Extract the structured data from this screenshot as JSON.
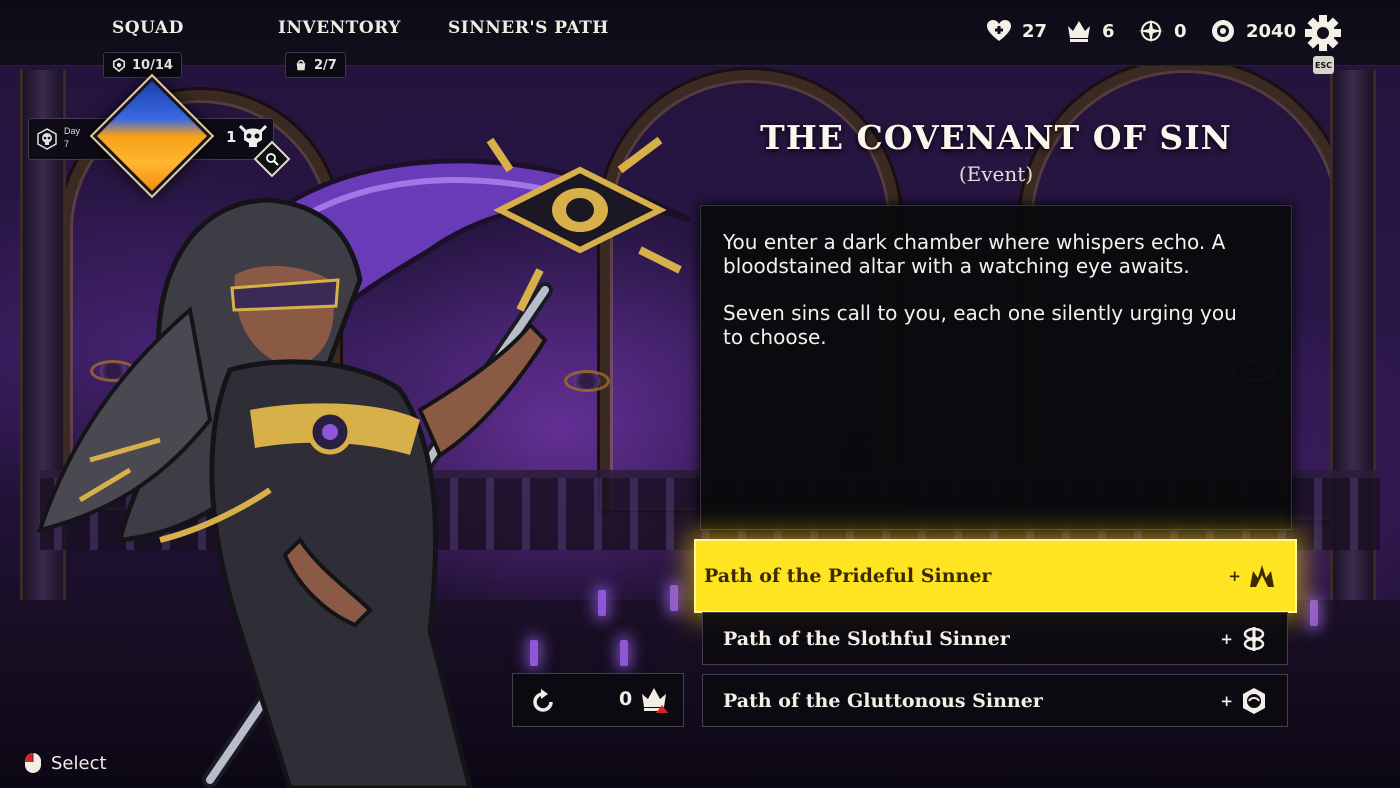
{
  "nav": {
    "squad": {
      "label": "SQUAD",
      "badge": "10/14"
    },
    "inventory": {
      "label": "INVENTORY",
      "badge": "2/7"
    },
    "sinners_path": {
      "label": "SINNER'S PATH"
    }
  },
  "stats": {
    "health": {
      "icon": "heart-plus-icon",
      "value": "27"
    },
    "crowns": {
      "icon": "crown-icon",
      "value": "6"
    },
    "compass": {
      "icon": "compass-icon",
      "value": "0"
    },
    "currency": {
      "icon": "coin-icon",
      "value": "2040"
    }
  },
  "settings": {
    "icon": "gear-icon",
    "shortcut": "ESC"
  },
  "day_panel": {
    "label": "Day",
    "day": "7",
    "skull_count": "1"
  },
  "event": {
    "title": "THE COVENANT OF SIN",
    "subtitle": "(Event)",
    "paragraphs": [
      "You enter a dark chamber where whispers echo. A bloodstained altar with a watching eye awaits.",
      "Seven sins call to you, each one silently urging you to choose."
    ]
  },
  "choices": [
    {
      "label": "Path of the Prideful Sinner",
      "reward_prefix": "+",
      "reward_icon": "pride-sin-icon",
      "selected": true
    },
    {
      "label": "Path of the Slothful Sinner",
      "reward_prefix": "+",
      "reward_icon": "sloth-sin-icon",
      "selected": false
    },
    {
      "label": "Path of the Gluttonous Sinner",
      "reward_prefix": "+",
      "reward_icon": "gluttony-sin-icon",
      "selected": false
    }
  ],
  "reroll": {
    "count": "0",
    "icon": "reroll-icon",
    "cost_icon": "crown-icon"
  },
  "hint": {
    "icon": "mouse-left-click-icon",
    "label": "Select"
  },
  "colors": {
    "selected_choice": "#ffe521",
    "accent_gold": "#c9a24a",
    "panel_bg": "#0a090c"
  }
}
